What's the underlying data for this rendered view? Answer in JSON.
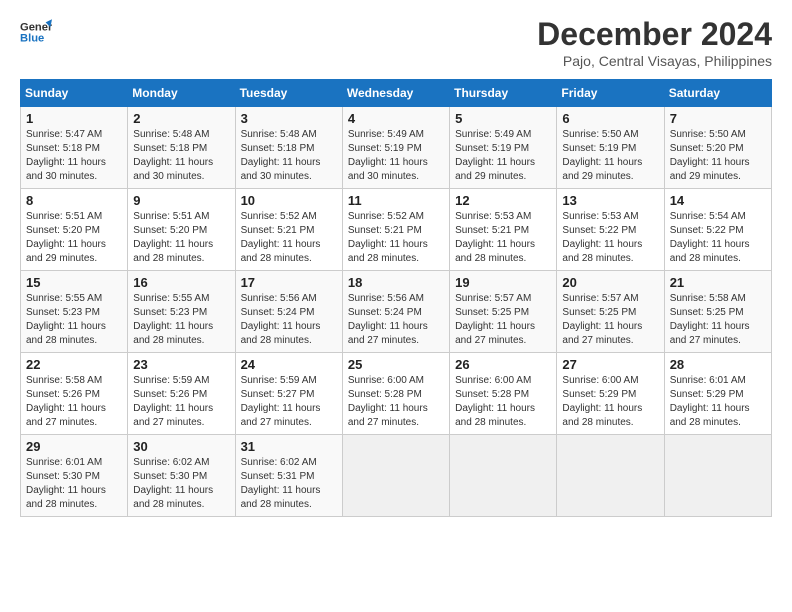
{
  "header": {
    "logo_line1": "General",
    "logo_line2": "Blue",
    "month": "December 2024",
    "location": "Pajo, Central Visayas, Philippines"
  },
  "calendar": {
    "days_of_week": [
      "Sunday",
      "Monday",
      "Tuesday",
      "Wednesday",
      "Thursday",
      "Friday",
      "Saturday"
    ],
    "weeks": [
      [
        {
          "day": "",
          "info": ""
        },
        {
          "day": "2",
          "info": "Sunrise: 5:48 AM\nSunset: 5:18 PM\nDaylight: 11 hours and 30 minutes."
        },
        {
          "day": "3",
          "info": "Sunrise: 5:48 AM\nSunset: 5:18 PM\nDaylight: 11 hours and 30 minutes."
        },
        {
          "day": "4",
          "info": "Sunrise: 5:49 AM\nSunset: 5:19 PM\nDaylight: 11 hours and 30 minutes."
        },
        {
          "day": "5",
          "info": "Sunrise: 5:49 AM\nSunset: 5:19 PM\nDaylight: 11 hours and 29 minutes."
        },
        {
          "day": "6",
          "info": "Sunrise: 5:50 AM\nSunset: 5:19 PM\nDaylight: 11 hours and 29 minutes."
        },
        {
          "day": "7",
          "info": "Sunrise: 5:50 AM\nSunset: 5:20 PM\nDaylight: 11 hours and 29 minutes."
        }
      ],
      [
        {
          "day": "1",
          "info": "Sunrise: 5:47 AM\nSunset: 5:18 PM\nDaylight: 11 hours and 30 minutes."
        },
        {
          "day": "9",
          "info": "Sunrise: 5:51 AM\nSunset: 5:20 PM\nDaylight: 11 hours and 28 minutes."
        },
        {
          "day": "10",
          "info": "Sunrise: 5:52 AM\nSunset: 5:21 PM\nDaylight: 11 hours and 28 minutes."
        },
        {
          "day": "11",
          "info": "Sunrise: 5:52 AM\nSunset: 5:21 PM\nDaylight: 11 hours and 28 minutes."
        },
        {
          "day": "12",
          "info": "Sunrise: 5:53 AM\nSunset: 5:21 PM\nDaylight: 11 hours and 28 minutes."
        },
        {
          "day": "13",
          "info": "Sunrise: 5:53 AM\nSunset: 5:22 PM\nDaylight: 11 hours and 28 minutes."
        },
        {
          "day": "14",
          "info": "Sunrise: 5:54 AM\nSunset: 5:22 PM\nDaylight: 11 hours and 28 minutes."
        }
      ],
      [
        {
          "day": "8",
          "info": "Sunrise: 5:51 AM\nSunset: 5:20 PM\nDaylight: 11 hours and 29 minutes."
        },
        {
          "day": "16",
          "info": "Sunrise: 5:55 AM\nSunset: 5:23 PM\nDaylight: 11 hours and 28 minutes."
        },
        {
          "day": "17",
          "info": "Sunrise: 5:56 AM\nSunset: 5:24 PM\nDaylight: 11 hours and 28 minutes."
        },
        {
          "day": "18",
          "info": "Sunrise: 5:56 AM\nSunset: 5:24 PM\nDaylight: 11 hours and 27 minutes."
        },
        {
          "day": "19",
          "info": "Sunrise: 5:57 AM\nSunset: 5:25 PM\nDaylight: 11 hours and 27 minutes."
        },
        {
          "day": "20",
          "info": "Sunrise: 5:57 AM\nSunset: 5:25 PM\nDaylight: 11 hours and 27 minutes."
        },
        {
          "day": "21",
          "info": "Sunrise: 5:58 AM\nSunset: 5:25 PM\nDaylight: 11 hours and 27 minutes."
        }
      ],
      [
        {
          "day": "15",
          "info": "Sunrise: 5:55 AM\nSunset: 5:23 PM\nDaylight: 11 hours and 28 minutes."
        },
        {
          "day": "23",
          "info": "Sunrise: 5:59 AM\nSunset: 5:26 PM\nDaylight: 11 hours and 27 minutes."
        },
        {
          "day": "24",
          "info": "Sunrise: 5:59 AM\nSunset: 5:27 PM\nDaylight: 11 hours and 27 minutes."
        },
        {
          "day": "25",
          "info": "Sunrise: 6:00 AM\nSunset: 5:28 PM\nDaylight: 11 hours and 27 minutes."
        },
        {
          "day": "26",
          "info": "Sunrise: 6:00 AM\nSunset: 5:28 PM\nDaylight: 11 hours and 28 minutes."
        },
        {
          "day": "27",
          "info": "Sunrise: 6:00 AM\nSunset: 5:29 PM\nDaylight: 11 hours and 28 minutes."
        },
        {
          "day": "28",
          "info": "Sunrise: 6:01 AM\nSunset: 5:29 PM\nDaylight: 11 hours and 28 minutes."
        }
      ],
      [
        {
          "day": "22",
          "info": "Sunrise: 5:58 AM\nSunset: 5:26 PM\nDaylight: 11 hours and 27 minutes."
        },
        {
          "day": "30",
          "info": "Sunrise: 6:02 AM\nSunset: 5:30 PM\nDaylight: 11 hours and 28 minutes."
        },
        {
          "day": "31",
          "info": "Sunrise: 6:02 AM\nSunset: 5:31 PM\nDaylight: 11 hours and 28 minutes."
        },
        {
          "day": "",
          "info": ""
        },
        {
          "day": "",
          "info": ""
        },
        {
          "day": "",
          "info": ""
        },
        {
          "day": "",
          "info": ""
        }
      ],
      [
        {
          "day": "29",
          "info": "Sunrise: 6:01 AM\nSunset: 5:30 PM\nDaylight: 11 hours and 28 minutes."
        },
        {
          "day": "",
          "info": ""
        },
        {
          "day": "",
          "info": ""
        },
        {
          "day": "",
          "info": ""
        },
        {
          "day": "",
          "info": ""
        },
        {
          "day": "",
          "info": ""
        },
        {
          "day": "",
          "info": ""
        }
      ]
    ]
  }
}
